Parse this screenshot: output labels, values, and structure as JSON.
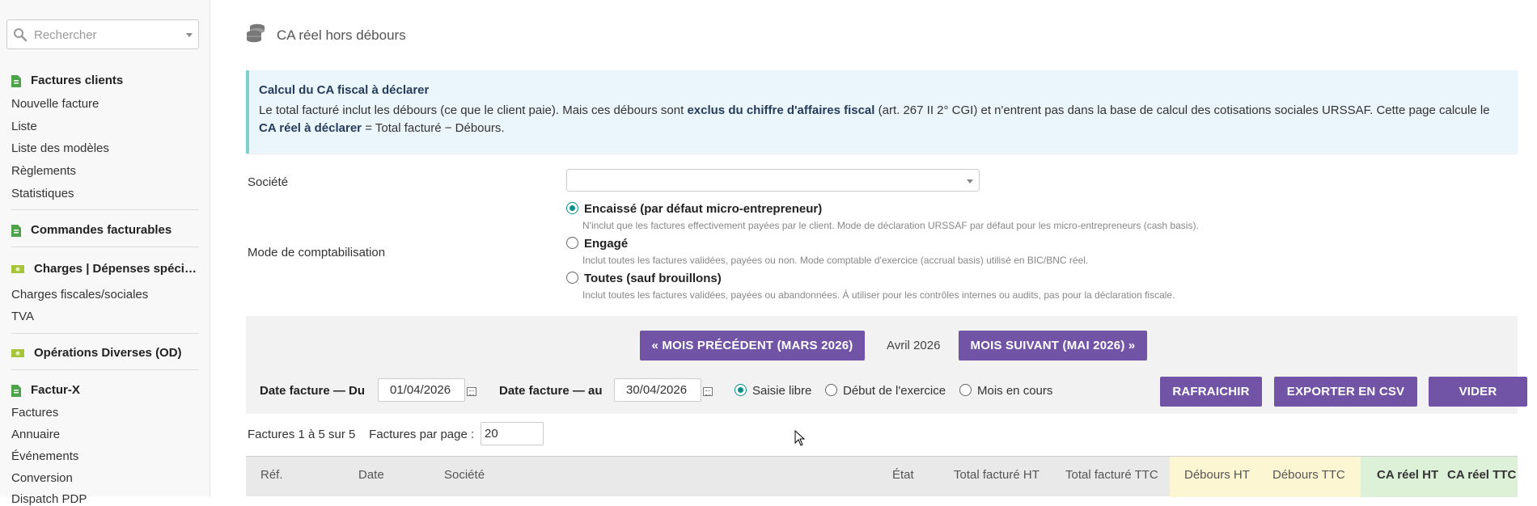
{
  "sidebar": {
    "search_placeholder": "Rechercher",
    "sections": [
      {
        "label": "Factures clients",
        "icon": "invoice-icon",
        "items": [
          "Nouvelle facture",
          "Liste",
          "Liste des modèles",
          "Règlements",
          "Statistiques"
        ]
      },
      {
        "label": "Commandes facturables",
        "icon": "invoice-icon",
        "items": []
      },
      {
        "label": "Charges | Dépenses spéci…",
        "icon": "money-icon",
        "items": [
          "Charges fiscales/sociales",
          "TVA"
        ]
      },
      {
        "label": "Opérations Diverses (OD)",
        "icon": "money-icon",
        "items": []
      },
      {
        "label": "Factur-X",
        "icon": "invoice-icon",
        "items": [
          "Factures",
          "Annuaire",
          "Événements",
          "Conversion",
          "Dispatch PDP"
        ]
      }
    ]
  },
  "page": {
    "title": "CA réel hors débours",
    "icon": "coins-icon"
  },
  "info": {
    "title": "Calcul du CA fiscal à déclarer",
    "text_1": "Le total facturé inclut les débours (ce que le client paie). Mais ces débours sont ",
    "bold_1": "exclus du chiffre d'affaires fiscal",
    "text_2": " (art. 267 II 2° CGI) et n'entrent pas dans la base de calcul des cotisations sociales URSSAF. Cette page calcule le ",
    "bold_2": "CA réel à déclarer",
    "text_3": " = Total facturé − Débours."
  },
  "form": {
    "societe_label": "Société",
    "societe_value": "",
    "mode_label": "Mode de comptabilisation",
    "modes": [
      {
        "label": "Encaissé (par défaut micro-entrepreneur)",
        "help": "N'inclut que les factures effectivement payées par le client. Mode de déclaration URSSAF par défaut pour les micro-entrepreneurs (cash basis).",
        "checked": true
      },
      {
        "label": "Engagé",
        "help": "Inclut toutes les factures validées, payées ou non. Mode comptable d'exercice (accrual basis) utilisé en BIC/BNC réel.",
        "checked": false
      },
      {
        "label": "Toutes (sauf brouillons)",
        "help": "Inclut toutes les factures validées, payées ou abandonnées. À utiliser pour les contrôles internes ou audits, pas pour la déclaration fiscale.",
        "checked": false
      }
    ]
  },
  "toolbar": {
    "prev_month": "« MOIS PRÉCÉDENT (MARS 2026)",
    "current_month": "Avril 2026",
    "next_month": "MOIS SUIVANT (MAI 2026) »",
    "date_from_label": "Date facture — Du",
    "date_from": "01/04/2026",
    "date_to_label": "Date facture — au",
    "date_to": "30/04/2026",
    "period_options": [
      {
        "label": "Saisie libre",
        "checked": true
      },
      {
        "label": "Début de l'exercice",
        "checked": false
      },
      {
        "label": "Mois en cours",
        "checked": false
      }
    ],
    "refresh": "RAFRAICHIR",
    "export": "EXPORTER EN CSV",
    "clear": "VIDER"
  },
  "pager": {
    "summary": "Factures 1 à 5 sur 5",
    "per_page_label": "Factures par page :",
    "per_page": "20"
  },
  "table": {
    "columns": [
      "Réf.",
      "Date",
      "Société",
      "État",
      "Total facturé HT",
      "Total facturé TTC",
      "Débours HT",
      "Débours TTC",
      "CA réel HT",
      "CA réel TTC"
    ]
  },
  "colors": {
    "accent_purple": "#7154a6",
    "info_bg": "#eaf6fb",
    "info_border": "#7fd1c9",
    "debours_bg": "#fdf6d3",
    "ca_reel_bg": "#dcf1d8",
    "radio_checked": "#0a8f89"
  }
}
